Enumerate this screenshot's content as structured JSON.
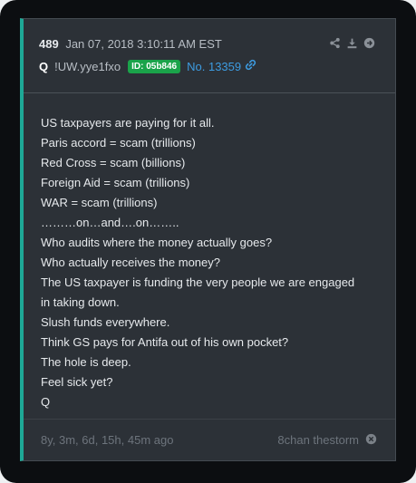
{
  "post": {
    "number": "489",
    "date": "Jan 07, 2018 3:10:11 AM EST",
    "author": "Q",
    "tripcode": "!UW.yye1fxo",
    "id_badge": "ID: 05b846",
    "post_link": "No. 13359",
    "lines": [
      "US taxpayers are paying for it all.",
      "Paris accord = scam (trillions)",
      "Red Cross = scam (billions)",
      "Foreign Aid = scam (trillions)",
      "WAR = scam (trillions)",
      "………on…and….on……..",
      "Who audits where the money actually goes?",
      "Who actually receives the money?",
      "The US taxpayer is funding the very people we are engaged",
      "in taking down.",
      "Slush funds everywhere.",
      "Think GS pays for Antifa out of his own pocket?",
      "The hole is deep.",
      "Feel sick yet?",
      "Q"
    ]
  },
  "footer": {
    "age": "8y, 3m, 6d, 15h, 45m ago",
    "source": "8chan thestorm"
  },
  "colors": {
    "accent": "#1ea896",
    "badge": "#1aa34a",
    "link": "#3d9be0",
    "panel": "#2c3137"
  },
  "icons": [
    "share-icon",
    "download-icon",
    "arrow-right-icon",
    "link-icon",
    "close-circle-icon"
  ]
}
